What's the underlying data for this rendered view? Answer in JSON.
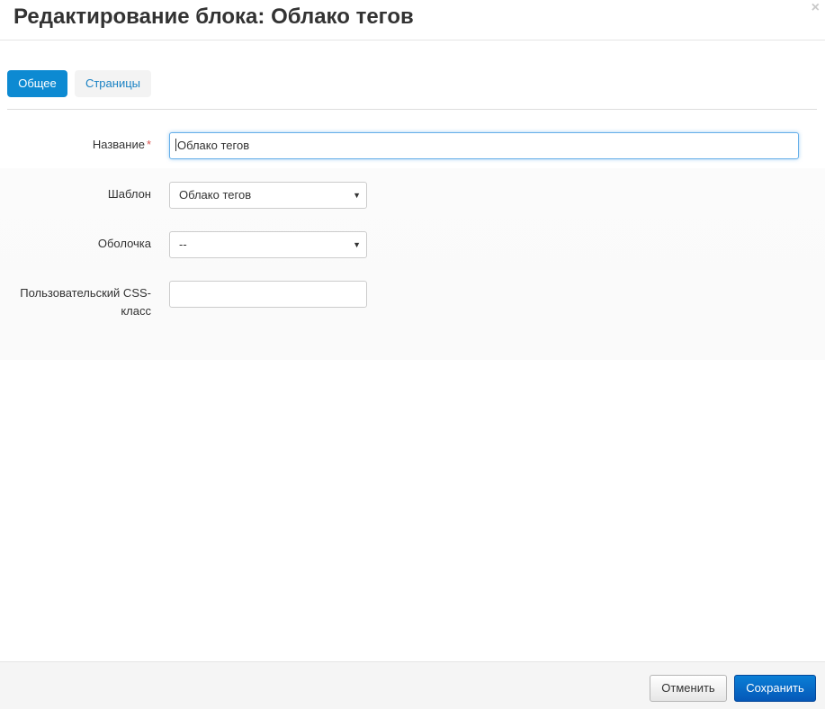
{
  "header": {
    "title": "Редактирование блока: Облако тегов",
    "close_glyph": "×"
  },
  "tabs": [
    {
      "label": "Общее",
      "active": true
    },
    {
      "label": "Страницы",
      "active": false
    }
  ],
  "form": {
    "name": {
      "label": "Название",
      "required_mark": "*",
      "value": "Облако тегов"
    },
    "template": {
      "label": "Шаблон",
      "selected": "Облако тегов"
    },
    "wrapper": {
      "label": "Оболочка",
      "selected": "--"
    },
    "css_class": {
      "label_line1": "Пользовательский CSS-",
      "label_line2": "класс",
      "value": ""
    }
  },
  "footer": {
    "cancel_label": "Отменить",
    "save_label": "Сохранить"
  },
  "colors": {
    "accent": "#0d8ad2",
    "save_button": "#0668c5",
    "required": "#d9534f"
  }
}
